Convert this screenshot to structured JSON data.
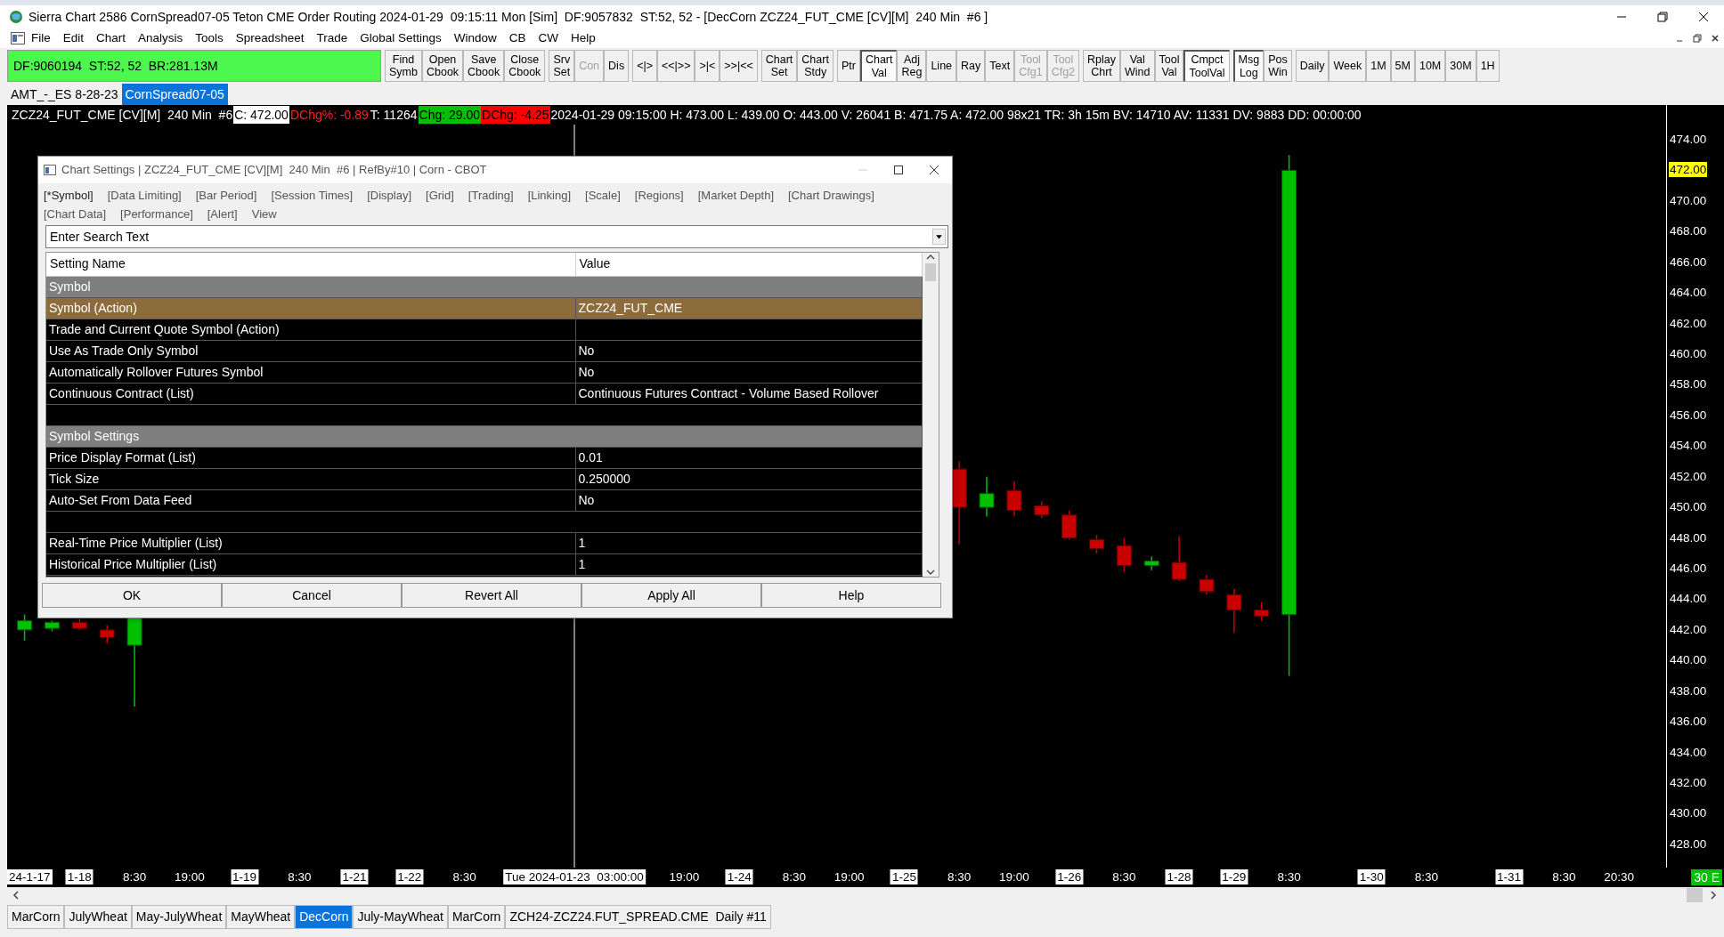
{
  "window": {
    "title": "Sierra Chart 2586 CornSpread07-05 Teton CME Order Routing 2024-01-29  09:15:11 Mon [Sim]  DF:9057832  ST:52, 52 - [DecCorn ZCZ24_FUT_CME [CV][M]  240 Min  #6 ]"
  },
  "menu": [
    "File",
    "Edit",
    "Chart",
    "Analysis",
    "Tools",
    "Spreadsheet",
    "Trade",
    "Global Settings",
    "Window",
    "CB",
    "CW",
    "Help"
  ],
  "toolbar": {
    "status": "DF:9060194  ST:52, 52  BR:281.13M",
    "groups": [
      [
        {
          "lines": [
            "Find",
            "Symb"
          ],
          "disabled": false,
          "pressed": false
        },
        {
          "lines": [
            "Open",
            "Cbook"
          ],
          "disabled": false,
          "pressed": false
        },
        {
          "lines": [
            "Save",
            "Cbook"
          ],
          "disabled": false,
          "pressed": false
        },
        {
          "lines": [
            "Close",
            "Cbook"
          ],
          "disabled": false,
          "pressed": false
        }
      ],
      [
        {
          "lines": [
            "Srv",
            "Set"
          ],
          "disabled": false,
          "pressed": false
        },
        {
          "lines": [
            "Con"
          ],
          "disabled": true,
          "pressed": false
        },
        {
          "lines": [
            "Dis"
          ],
          "disabled": false,
          "pressed": false
        }
      ],
      [
        {
          "lines": [
            "<|>"
          ],
          "disabled": false,
          "pressed": false
        },
        {
          "lines": [
            "<<|>>"
          ],
          "disabled": false,
          "pressed": false
        },
        {
          "lines": [
            ">|<"
          ],
          "disabled": false,
          "pressed": false
        },
        {
          "lines": [
            ">>|<<"
          ],
          "disabled": false,
          "pressed": false
        }
      ],
      [
        {
          "lines": [
            "Chart",
            "Set"
          ],
          "disabled": false,
          "pressed": false
        },
        {
          "lines": [
            "Chart",
            "Stdy"
          ],
          "disabled": false,
          "pressed": false
        }
      ],
      [
        {
          "lines": [
            "Ptr"
          ],
          "disabled": false,
          "pressed": false
        },
        {
          "lines": [
            "Chart",
            "Val"
          ],
          "disabled": false,
          "pressed": true
        },
        {
          "lines": [
            "Adj",
            "Reg"
          ],
          "disabled": false,
          "pressed": false
        },
        {
          "lines": [
            "Line"
          ],
          "disabled": false,
          "pressed": false
        },
        {
          "lines": [
            "Ray"
          ],
          "disabled": false,
          "pressed": false
        },
        {
          "lines": [
            "Text"
          ],
          "disabled": false,
          "pressed": false
        },
        {
          "lines": [
            "Tool",
            "Cfg1"
          ],
          "disabled": true,
          "pressed": false
        },
        {
          "lines": [
            "Tool",
            "Cfg2"
          ],
          "disabled": true,
          "pressed": false
        }
      ],
      [
        {
          "lines": [
            "Rplay",
            "Chrt"
          ],
          "disabled": false,
          "pressed": false
        },
        {
          "lines": [
            "Val",
            "Wind"
          ],
          "disabled": false,
          "pressed": false
        },
        {
          "lines": [
            "Tool",
            "Val"
          ],
          "disabled": false,
          "pressed": false
        },
        {
          "lines": [
            "Cmpct",
            "ToolVal"
          ],
          "disabled": false,
          "pressed": true
        }
      ],
      [
        {
          "lines": [
            "Msg",
            "Log"
          ],
          "disabled": false,
          "pressed": true
        },
        {
          "lines": [
            "Pos",
            "Win"
          ],
          "disabled": false,
          "pressed": false
        }
      ],
      [
        {
          "lines": [
            "Daily"
          ],
          "disabled": false,
          "pressed": false
        },
        {
          "lines": [
            "Week"
          ],
          "disabled": false,
          "pressed": false
        },
        {
          "lines": [
            "1M"
          ],
          "disabled": false,
          "pressed": false
        },
        {
          "lines": [
            "5M"
          ],
          "disabled": false,
          "pressed": false
        },
        {
          "lines": [
            "10M"
          ],
          "disabled": false,
          "pressed": false
        },
        {
          "lines": [
            "30M"
          ],
          "disabled": false,
          "pressed": false
        },
        {
          "lines": [
            "1H"
          ],
          "disabled": false,
          "pressed": false
        }
      ]
    ]
  },
  "chartbooks": [
    {
      "label": "AMT_-_ES 8-28-23",
      "selected": false
    },
    {
      "label": "CornSpread07-05",
      "selected": true
    }
  ],
  "chart": {
    "header": [
      {
        "text": "ZCZ24_FUT_CME [CV][M]  240 Min  #6",
        "kind": "plain"
      },
      {
        "text": "C: 472.00",
        "kind": "inverse"
      },
      {
        "text": "DChg%: -0.89",
        "kind": "negative"
      },
      {
        "text": "T: 11264",
        "kind": "plain"
      },
      {
        "text": "Chg: 29.00",
        "kind": "up"
      },
      {
        "text": "DChg: -4.25",
        "kind": "down"
      },
      {
        "text": "2024-01-29 09:15:00 H: 473.00 L: 439.00 O: 443.00 V: 26041 B: 471.75 A: 472.00 98x21 TR: 3h 15m BV: 14710 AV: 11331 DV: 9883 DD: 00:00:00",
        "kind": "plain"
      }
    ],
    "y_axis": [
      {
        "label": "474.00",
        "kind": "tick"
      },
      {
        "label": "472.00",
        "kind": "current"
      },
      {
        "label": "470.00",
        "kind": "tick"
      },
      {
        "label": "468.00",
        "kind": "tick"
      },
      {
        "label": "466.00",
        "kind": "tick"
      },
      {
        "label": "464.00",
        "kind": "tick"
      },
      {
        "label": "462.00",
        "kind": "tick"
      },
      {
        "label": "460.00",
        "kind": "tick"
      },
      {
        "label": "458.00",
        "kind": "tick"
      },
      {
        "label": "456.00",
        "kind": "tick"
      },
      {
        "label": "454.00",
        "kind": "tick"
      },
      {
        "label": "452.00",
        "kind": "tick"
      },
      {
        "label": "450.00",
        "kind": "tick"
      },
      {
        "label": "448.00",
        "kind": "tick"
      },
      {
        "label": "446.00",
        "kind": "tick"
      },
      {
        "label": "444.00",
        "kind": "tick"
      },
      {
        "label": "442.00",
        "kind": "tick"
      },
      {
        "label": "440.00",
        "kind": "tick"
      },
      {
        "label": "438.00",
        "kind": "tick"
      },
      {
        "label": "436.00",
        "kind": "tick"
      },
      {
        "label": "434.00",
        "kind": "tick"
      },
      {
        "label": "432.00",
        "kind": "tick"
      },
      {
        "label": "430.00",
        "kind": "tick"
      },
      {
        "label": "428.00",
        "kind": "tick"
      }
    ],
    "x_axis": [
      {
        "label": "24-1-17",
        "kind": "date"
      },
      {
        "label": "1-18",
        "kind": "date"
      },
      {
        "label": "8:30",
        "kind": "time"
      },
      {
        "label": "19:00",
        "kind": "time"
      },
      {
        "label": "1-19",
        "kind": "date"
      },
      {
        "label": "8:30",
        "kind": "time"
      },
      {
        "label": "1-21",
        "kind": "date"
      },
      {
        "label": "1-22",
        "kind": "date"
      },
      {
        "label": "8:30",
        "kind": "time"
      },
      {
        "label": "Tue 2024-01-23  03:00:00",
        "kind": "cursor"
      },
      {
        "label": "19:00",
        "kind": "time"
      },
      {
        "label": "1-24",
        "kind": "date"
      },
      {
        "label": "8:30",
        "kind": "time"
      },
      {
        "label": "19:00",
        "kind": "time"
      },
      {
        "label": "1-25",
        "kind": "date"
      },
      {
        "label": "8:30",
        "kind": "time"
      },
      {
        "label": "19:00",
        "kind": "time"
      },
      {
        "label": "1-26",
        "kind": "date"
      },
      {
        "label": "8:30",
        "kind": "time"
      },
      {
        "label": "1-28",
        "kind": "date"
      },
      {
        "label": "1-29",
        "kind": "date"
      },
      {
        "label": "8:30",
        "kind": "time"
      },
      {
        "label": "1-30",
        "kind": "date"
      },
      {
        "label": "8:30",
        "kind": "time"
      },
      {
        "label": "1-31",
        "kind": "date"
      },
      {
        "label": "8:30",
        "kind": "time"
      },
      {
        "label": "20:30",
        "kind": "time"
      }
    ],
    "corner": "30 E"
  },
  "dialog": {
    "title": "Chart Settings | ZCZ24_FUT_CME [CV][M]  240 Min  #6 | RefBy#10 | Corn - CBOT",
    "tabs": [
      {
        "label": "[*Symbol]",
        "selected": true
      },
      {
        "label": "[Data Limiting]",
        "selected": false
      },
      {
        "label": "[Bar Period]",
        "selected": false
      },
      {
        "label": "[Session Times]",
        "selected": false
      },
      {
        "label": "[Display]",
        "selected": false
      },
      {
        "label": "[Grid]",
        "selected": false
      },
      {
        "label": "[Trading]",
        "selected": false
      },
      {
        "label": "[Linking]",
        "selected": false
      },
      {
        "label": "[Scale]",
        "selected": false
      },
      {
        "label": "[Regions]",
        "selected": false
      },
      {
        "label": "[Market Depth]",
        "selected": false
      },
      {
        "label": "[Chart Drawings]",
        "selected": false
      },
      {
        "label": "[Chart Data]",
        "selected": false
      },
      {
        "label": "[Performance]",
        "selected": false
      },
      {
        "label": "[Alert]",
        "selected": false
      },
      {
        "label": "View",
        "selected": false
      }
    ],
    "search": {
      "placeholder": "Enter Search Text"
    },
    "columns": [
      "Setting Name",
      "Value"
    ],
    "rows": [
      {
        "kind": "section",
        "name": "Symbol"
      },
      {
        "kind": "setting",
        "name": "Symbol (Action)",
        "value": "ZCZ24_FUT_CME",
        "selected": true
      },
      {
        "kind": "setting",
        "name": "Trade and Current Quote Symbol (Action)",
        "selected": false
      },
      {
        "kind": "setting",
        "name": "Use As Trade Only Symbol",
        "value": "No",
        "selected": false
      },
      {
        "kind": "setting",
        "name": "Automatically Rollover Futures Symbol",
        "value": "No",
        "selected": false
      },
      {
        "kind": "setting",
        "name": "Continuous Contract (List)",
        "value": "Continuous Futures Contract - Volume Based Rollover",
        "selected": false
      },
      {
        "kind": "blank"
      },
      {
        "kind": "section",
        "name": "Symbol Settings"
      },
      {
        "kind": "setting",
        "name": "Price Display Format (List)",
        "value": "0.01",
        "selected": false
      },
      {
        "kind": "setting",
        "name": "Tick Size",
        "value": "0.250000",
        "selected": false
      },
      {
        "kind": "setting",
        "name": "Auto-Set From Data Feed",
        "value": "No",
        "selected": false
      },
      {
        "kind": "blank"
      },
      {
        "kind": "setting",
        "name": "Real-Time Price Multiplier (List)",
        "value": "1",
        "selected": false
      },
      {
        "kind": "setting",
        "name": "Historical Price Multiplier (List)",
        "value": "1",
        "selected": false
      }
    ],
    "buttons": [
      "OK",
      "Cancel",
      "Revert All",
      "Apply All",
      "Help"
    ]
  },
  "sheet_tabs": [
    {
      "label": "MarCorn",
      "selected": false
    },
    {
      "label": "JulyWheat",
      "selected": false
    },
    {
      "label": "May-JulyWheat",
      "selected": false
    },
    {
      "label": "MayWheat",
      "selected": false
    },
    {
      "label": "DecCorn",
      "selected": true
    },
    {
      "label": "July-MayWheat",
      "selected": false
    },
    {
      "label": "MarCorn",
      "selected": false
    },
    {
      "label": "ZCH24-ZCZ24.FUT_SPREAD.CME  Daily #11",
      "selected": false
    }
  ]
}
